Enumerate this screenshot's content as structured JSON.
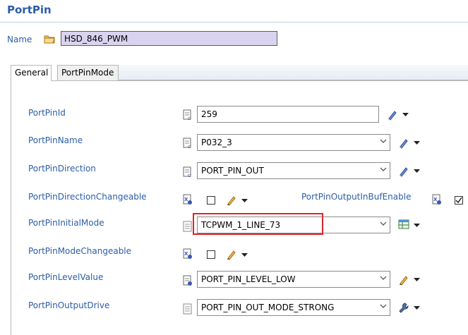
{
  "header": {
    "title": "PortPin"
  },
  "name": {
    "label": "Name",
    "value": "HSD_846_PWM"
  },
  "tabs": [
    {
      "label": "General",
      "active": true
    },
    {
      "label": "PortPinMode",
      "active": false
    }
  ],
  "fields": {
    "port_pin_id": {
      "label": "PortPinId",
      "value": "259"
    },
    "port_pin_name": {
      "label": "PortPinName",
      "value": "P032_3"
    },
    "port_pin_direction": {
      "label": "PortPinDirection",
      "value": "PORT_PIN_OUT"
    },
    "direction_changeable": {
      "label": "PortPinDirectionChangeable",
      "checked": false
    },
    "output_in_buf_enable": {
      "label": "PortPinOutputInBufEnable",
      "checked": true
    },
    "initial_mode": {
      "label": "PortPinInitialMode",
      "value": "TCPWM_1_LINE_73"
    },
    "mode_changeable": {
      "label": "PortPinModeChangeable",
      "checked": false
    },
    "level_value": {
      "label": "PortPinLevelValue",
      "value": "PORT_PIN_LEVEL_LOW"
    },
    "output_drive": {
      "label": "PortPinOutputDrive",
      "value": "PORT_PIN_OUT_MODE_STRONG"
    }
  },
  "colors": {
    "label_blue": "#2b5da8",
    "highlight_red": "#d9262b",
    "name_field_bg": "#d9d3f0"
  }
}
